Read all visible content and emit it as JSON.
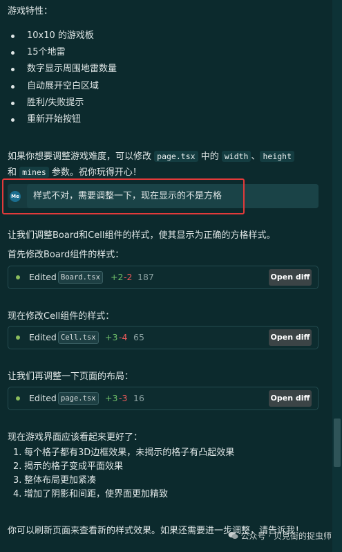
{
  "features": {
    "heading": "游戏特性：",
    "items": [
      "10x10 的游戏板",
      "15个地雷",
      "数字显示周围地雷数量",
      "自动展开空白区域",
      "胜利/失败提示",
      "重新开始按钮"
    ]
  },
  "tip": {
    "part1": "如果你想要调整游戏难度，可以修改",
    "file": "page.tsx",
    "part2": "中的",
    "code_width": "width",
    "sep": "、",
    "code_height": "height",
    "and": "和",
    "code_mines": "mines",
    "part3": "参数。祝你玩得开心！"
  },
  "user_message": {
    "avatar": "Me",
    "text": "样式不对，需要调整一下，现在显示的不是方格"
  },
  "reply": {
    "line1": "让我们调整Board和Cell组件的样式，使其显示为正确的方格样式。",
    "line2": "首先修改Board组件的样式：",
    "line3": "现在修改Cell组件的样式：",
    "line4": "让我们再调整一下页面的布局：",
    "line5": "现在游戏界面应该看起来更好了：",
    "improvements": [
      {
        "n": "1.",
        "text": "每个格子都有3D边框效果，未揭示的格子有凸起效果"
      },
      {
        "n": "2.",
        "text": "揭示的格子变成平面效果"
      },
      {
        "n": "3.",
        "text": "整体布局更加紧凑"
      },
      {
        "n": "4.",
        "text": "增加了阴影和间距，使界面更加精致"
      }
    ],
    "final": "你可以刷新页面来查看新的样式效果。如果还需要进一步调整，请告诉我！"
  },
  "edits": [
    {
      "label": "Edited",
      "file": "Board.tsx",
      "added": "+2",
      "removed": "-2",
      "count": "187",
      "button": "Open diff"
    },
    {
      "label": "Edited",
      "file": "Cell.tsx",
      "added": "+3",
      "removed": "-4",
      "count": "65",
      "button": "Open diff"
    },
    {
      "label": "Edited",
      "file": "page.tsx",
      "added": "+3",
      "removed": "-3",
      "count": "16",
      "button": "Open diff"
    }
  ],
  "watermark": "公众号 · 贝克街的捉虫师",
  "colors": {
    "background": "#0c2a2d",
    "highlight_border": "#e23a3a",
    "added": "#6fc06a",
    "removed": "#f05a5a",
    "status_dot": "#8bbd5d"
  }
}
